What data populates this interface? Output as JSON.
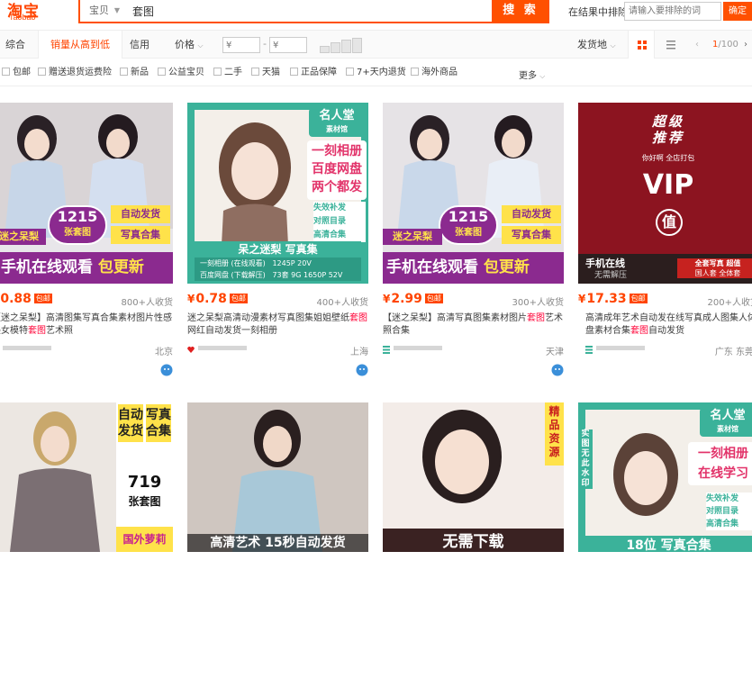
{
  "logo": {
    "main": "淘宝",
    "sub": "Taobao"
  },
  "search": {
    "type_label": "宝贝",
    "query": "套图",
    "button": "搜 索"
  },
  "refine": {
    "label": "在结果中排除",
    "placeholder": "请输入要排除的词",
    "confirm": "确定"
  },
  "sort": {
    "tabs": [
      "综合",
      "销量从高到低",
      "信用",
      "价格"
    ],
    "price_placeholder": "¥",
    "price_sep": "-",
    "ship_from": "发货地",
    "pager": {
      "current": "1",
      "total": "/100"
    }
  },
  "filters": [
    "包邮",
    "赠送退货运费险",
    "新品",
    "公益宝贝",
    "二手",
    "天猫",
    "正品保障",
    "7+天内退货",
    "海外商品"
  ],
  "more": "更多",
  "products": [
    {
      "price": "0.88",
      "badge": "包邮",
      "sales": "800+人收货",
      "title_parts": [
        "【迷之呆梨】高清图集写真合集素材图片性感美女模特",
        "套图",
        "艺术照"
      ],
      "location": "北京",
      "pic": {
        "count": "1215",
        "count_sub": "张套图",
        "left_tag": "迷之呆梨",
        "right_tag1": "自动发货",
        "right_tag2": "写真合集",
        "bottom": "手机在线观看",
        "bottom_tag": "包更新"
      }
    },
    {
      "price": "0.78",
      "badge": "包邮",
      "sales": "400+人收货",
      "title_parts": [
        "迷之呆梨高清动漫素材写真图集姐姐壁纸",
        "套图",
        "网红自动发货一刻相册"
      ],
      "location": "上海",
      "pic": {
        "corner": "名人堂",
        "corner_sub": "素材馆",
        "line1": "一刻相册",
        "line2": "百度网盘",
        "line3": "两个都发",
        "feat1": "失效补发",
        "feat2": "对照目录",
        "feat3": "高清合集",
        "strip": "呆之迷梨  写真集",
        "strip_l1": "一刻相册 (在线观看)",
        "strip_l2": "百度网盘 (下载解压)",
        "strip_r1": "1245P 20V",
        "strip_r2": "73套 9G 1650P 52V"
      }
    },
    {
      "price": "2.99",
      "badge": "包邮",
      "sales": "300+人收货",
      "title_parts": [
        "【迷之呆梨】高清写真图集素材图片",
        "套图",
        "艺术照合集"
      ],
      "location": "天津",
      "pic": {
        "count": "1215",
        "count_sub": "张套图",
        "left_tag": "迷之呆梨",
        "right_tag1": "自动发货",
        "right_tag2": "写真合集",
        "bottom": "手机在线观看",
        "bottom_tag": "包更新"
      }
    },
    {
      "price": "17.33",
      "badge": "包邮",
      "sales": "200+人收货",
      "title_parts": [
        "高清成年艺术自动发在线写真成人图集人体盘素材合集",
        "套图",
        "自动发货"
      ],
      "location": "广东 东莞",
      "pic": {
        "top1": "超级",
        "top2": "推荐",
        "sub": "你好啊  全店打包",
        "vip": "VIP",
        "seal": "值",
        "b1": "手机在线",
        "b2": "无需解压",
        "b3": "全套写真 超值",
        "b4": "国人套 全体套"
      }
    },
    {
      "pic": {
        "v1": "自动发货",
        "v2": "写真合集",
        "count": "719",
        "count_sub": "张套图",
        "bottom": "国外萝莉"
      }
    },
    {
      "pic": {
        "bottom": "高清艺术 15秒自动发货"
      }
    },
    {
      "pic": {
        "side": "精品资源",
        "bottom": "无需下载"
      }
    },
    {
      "pic": {
        "corner": "名人堂",
        "corner_sub": "素材馆",
        "side": "实图无此水印",
        "line1": "一刻相册",
        "line2": "在线学习",
        "feat1": "失效补发",
        "feat2": "对照目录",
        "feat3": "高清合集",
        "bottom": "18位 写真合集"
      }
    }
  ],
  "colors": {
    "brand": "#ff5000",
    "price": "#ff4400",
    "highlight": "#ff0036",
    "purple": "#8b2a8f"
  }
}
